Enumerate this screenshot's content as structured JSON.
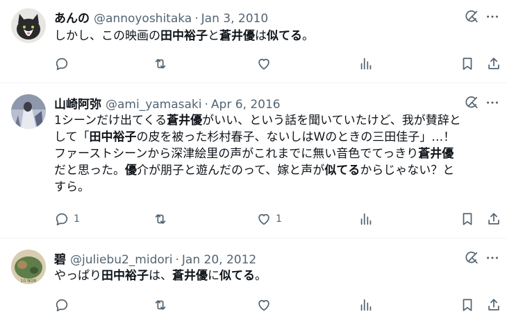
{
  "tweets": [
    {
      "name": "あんの",
      "handle": "@annoyoshitaka",
      "sep": "·",
      "date": "Jan 3, 2010",
      "body": [
        {
          "t": "しかし、この映画の",
          "b": false
        },
        {
          "t": "田中裕子",
          "b": true
        },
        {
          "t": "と",
          "b": false
        },
        {
          "t": "蒼井優",
          "b": true
        },
        {
          "t": "は",
          "b": false
        },
        {
          "t": "似てる",
          "b": true
        },
        {
          "t": "。",
          "b": false
        }
      ],
      "replies": "",
      "likes": ""
    },
    {
      "name": "山崎阿弥",
      "handle": "@ami_yamasaki",
      "sep": "·",
      "date": "Apr 6, 2016",
      "body": [
        {
          "t": "1シーンだけ出てくる",
          "b": false
        },
        {
          "t": "蒼井優",
          "b": true
        },
        {
          "t": "がいい、という話を聞いていたけど、我が賛辞と",
          "b": false
        },
        {
          "br": true
        },
        {
          "t": "して「",
          "b": false
        },
        {
          "t": "田中裕子",
          "b": true
        },
        {
          "t": "の皮を被った杉村春子、ないしはWのときの三田佳子」…！",
          "b": false
        },
        {
          "br": true
        },
        {
          "t": "ファーストシーンから深津絵里の声がこれまでに無い音色でてっきり",
          "b": false
        },
        {
          "t": "蒼井優",
          "b": true
        },
        {
          "br": true
        },
        {
          "t": "だと思った。",
          "b": false
        },
        {
          "t": "優",
          "b": true
        },
        {
          "t": "介が朋子と遊んだのって、嫁と声が",
          "b": false
        },
        {
          "t": "似てる",
          "b": true
        },
        {
          "t": "からじゃない？と",
          "b": false
        },
        {
          "br": true
        },
        {
          "t": "すら。",
          "b": false
        }
      ],
      "replies": "1",
      "likes": "1"
    },
    {
      "name": "碧",
      "handle": "@juliebu2_midori",
      "sep": "·",
      "date": "Jan 20, 2012",
      "body": [
        {
          "t": "やっぱり",
          "b": false
        },
        {
          "t": "田中裕子",
          "b": true
        },
        {
          "t": "は、",
          "b": false
        },
        {
          "t": "蒼井優",
          "b": true
        },
        {
          "t": "に",
          "b": false
        },
        {
          "t": "似てる",
          "b": true
        },
        {
          "t": "。",
          "b": false
        }
      ],
      "replies": "",
      "likes": ""
    }
  ],
  "avatar_text": "10 NOR",
  "icons": {
    "grok": "grok-icon",
    "more": "more-icon",
    "reply": "reply-icon",
    "repost": "repost-icon",
    "like": "like-icon",
    "views": "views-icon",
    "bookmark": "bookmark-icon",
    "share": "share-icon"
  },
  "colors": {
    "text": "#0f1419",
    "muted": "#536471",
    "divider": "#eff3f4"
  }
}
